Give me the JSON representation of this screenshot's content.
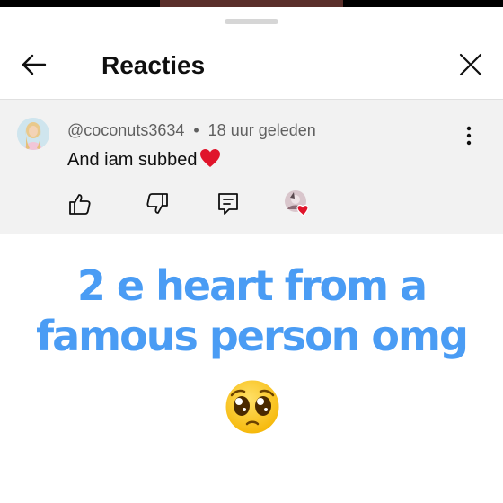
{
  "sheet": {
    "title": "Reacties"
  },
  "comment": {
    "author": "@coconuts3634",
    "separator": "•",
    "time": "18 uur geleden",
    "text": "And iam subbed"
  },
  "overlay": {
    "line1": "2 e heart from a",
    "line2": "famous person omg"
  },
  "icons": {
    "back": "arrow-left-icon",
    "close": "close-icon",
    "more": "more-vertical-icon",
    "like": "thumb-up-icon",
    "dislike": "thumb-down-icon",
    "reply": "reply-icon",
    "creator_heart": "creator-heart-icon",
    "emoji": "pleading-face-icon"
  },
  "colors": {
    "caption": "#4a9cf4",
    "heart": "#e0142b",
    "comment_bg": "#f2f2f2"
  }
}
